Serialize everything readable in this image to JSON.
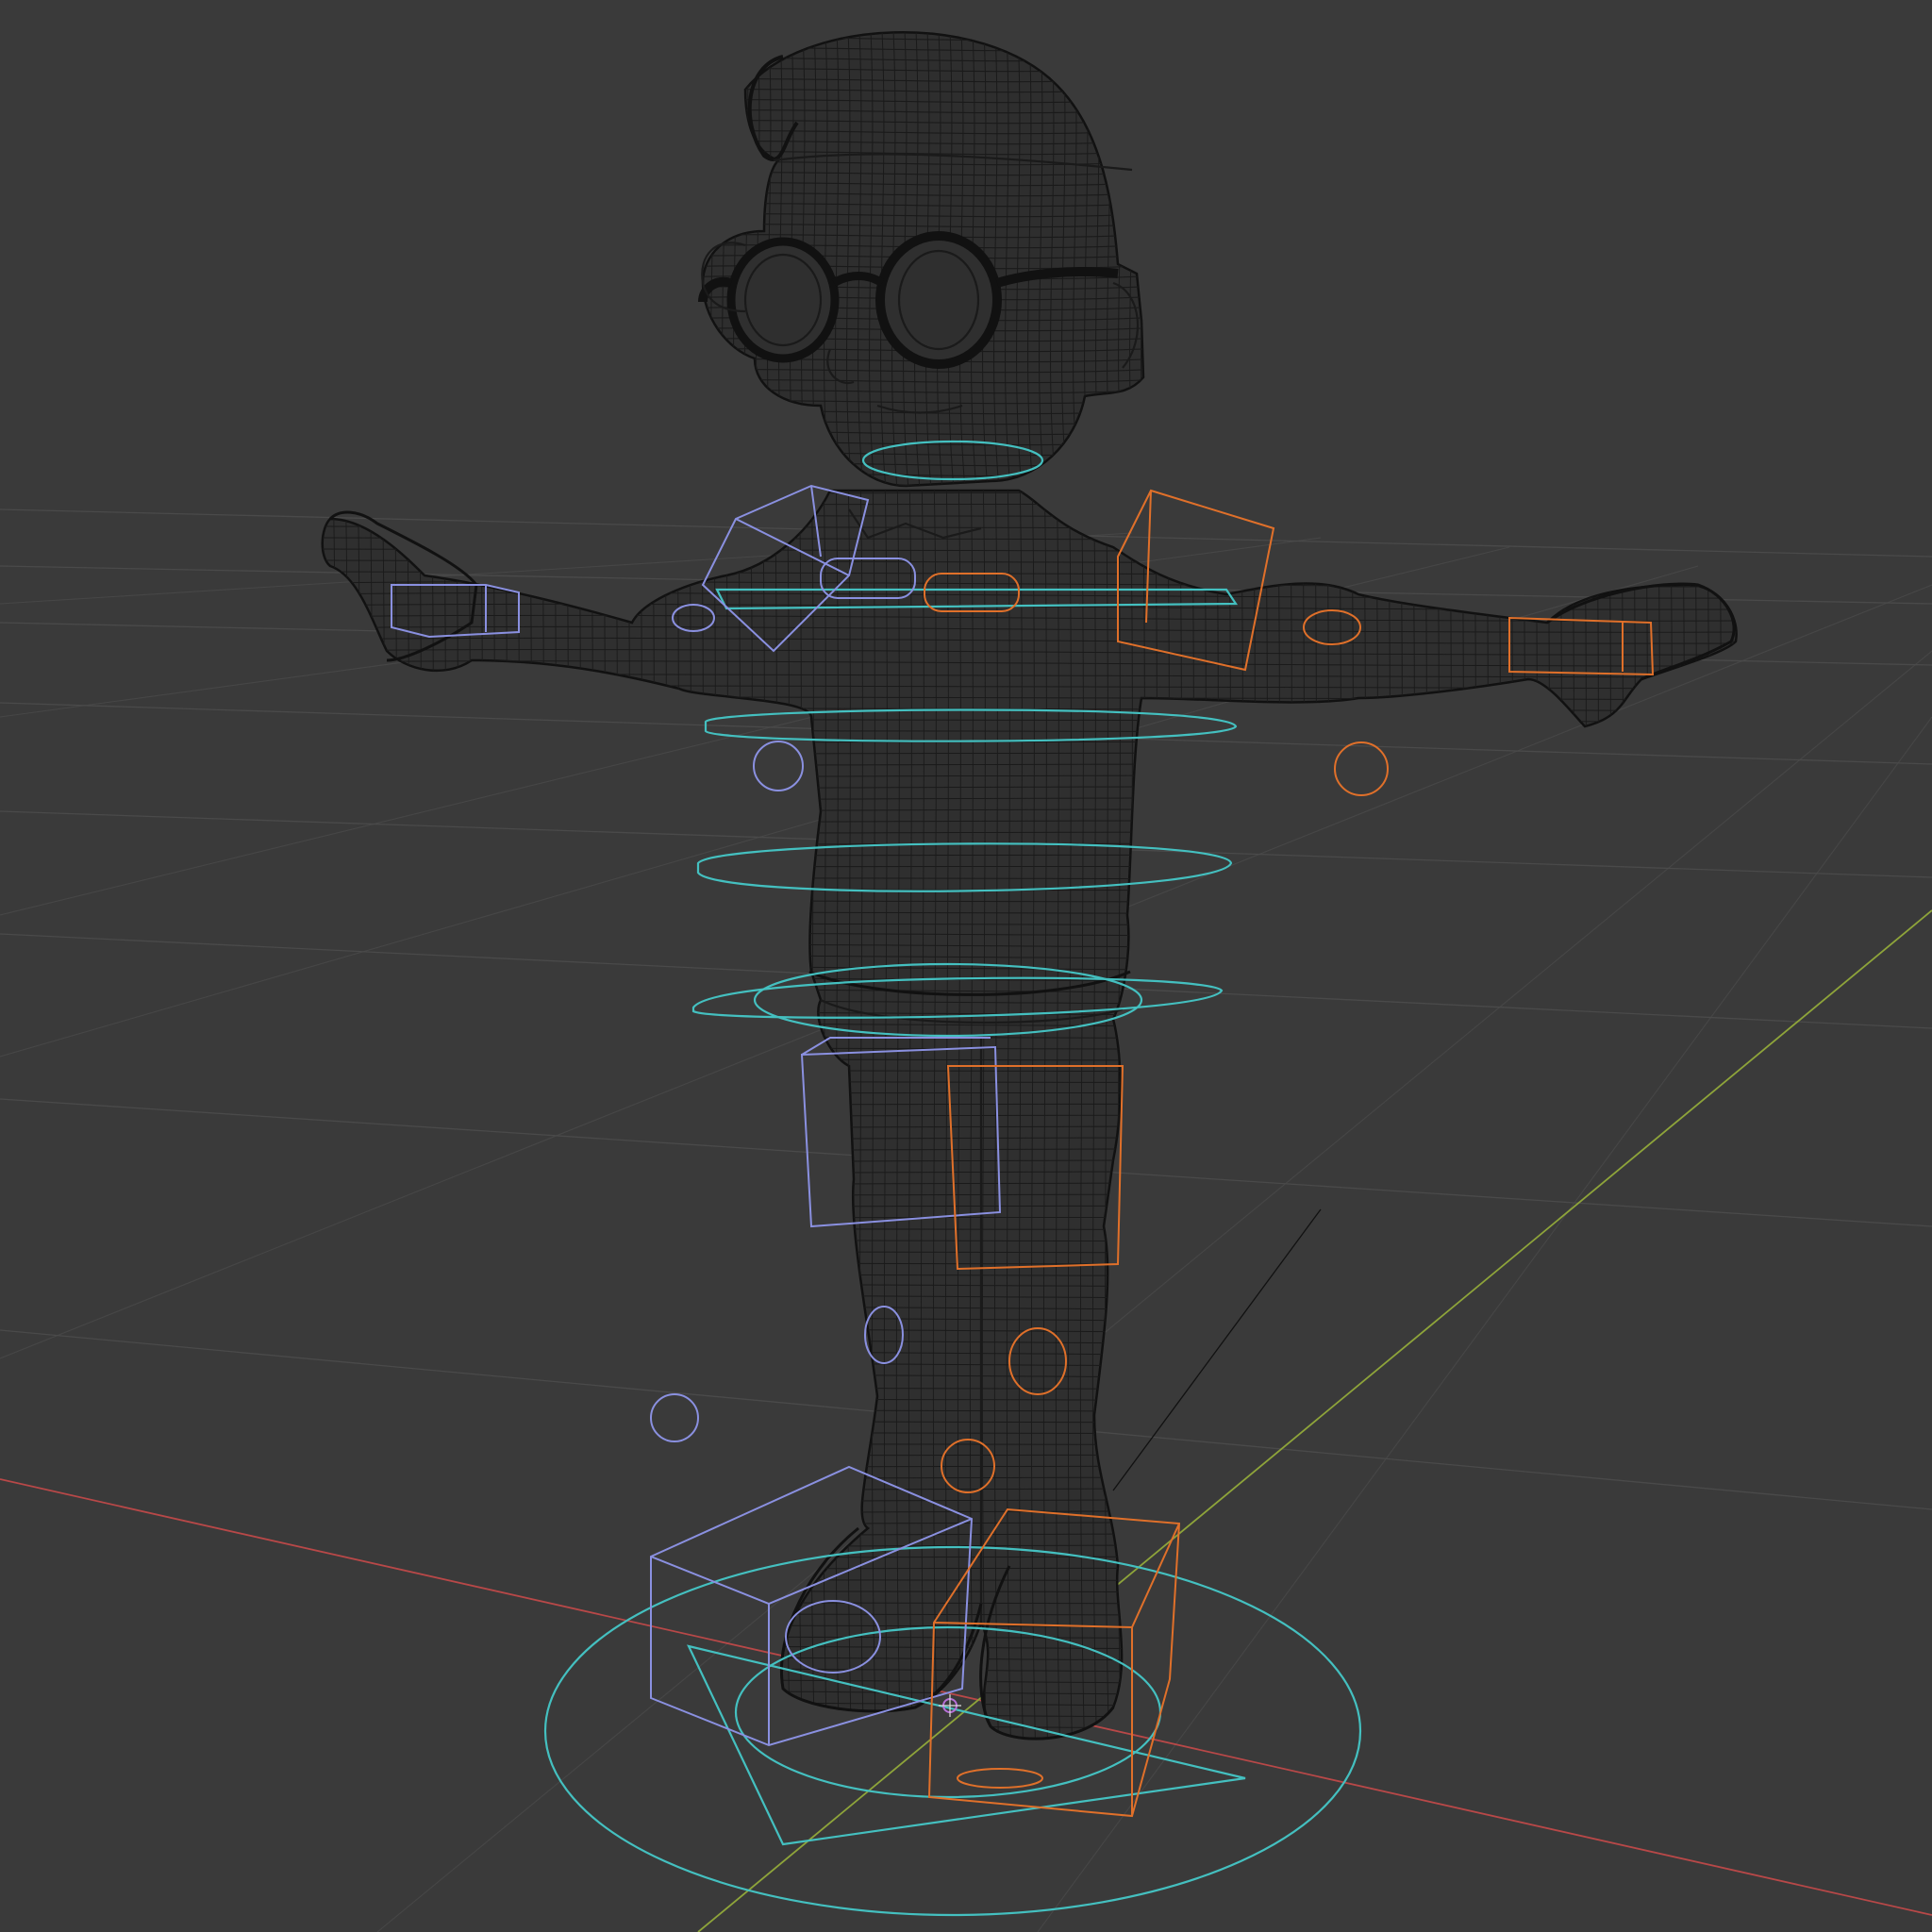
{
  "viewport": {
    "mode": "wireframe",
    "shading": "wireframe",
    "background_color": "#3a3a3a"
  },
  "scene": {
    "object": "character-mesh",
    "rig": "character-rig-controls"
  },
  "colors": {
    "grid": "#4a4a4a",
    "x_axis": "#b84848",
    "y_axis": "#8ea43a",
    "mesh_wire": "#1a1a1a",
    "control_center": "#44c0c0",
    "control_left": "#8a90e0",
    "control_right": "#e0702a"
  }
}
